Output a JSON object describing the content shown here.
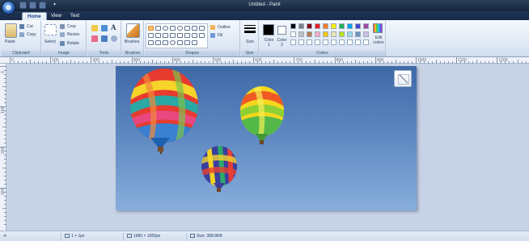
{
  "window": {
    "title": "Untitled - Paint"
  },
  "tabs": [
    {
      "label": "Home",
      "active": true
    },
    {
      "label": "View",
      "active": false
    },
    {
      "label": "Text",
      "active": false
    }
  ],
  "ribbon": {
    "clipboard": {
      "group_label": "Clipboard",
      "paste_label": "Paste",
      "cut_label": "Cut",
      "copy_label": "Copy"
    },
    "image": {
      "group_label": "Image",
      "select_label": "Select",
      "crop_label": "Crop",
      "resize_label": "Resize",
      "rotate_label": "Rotate"
    },
    "tools": {
      "group_label": "Tools",
      "text_tool_label": "A"
    },
    "brushes": {
      "group_label": "Brushes",
      "brushes_label": "Brushes"
    },
    "shapes": {
      "group_label": "Shapes",
      "outline_label": "Outline",
      "fill_label": "Fill"
    },
    "size": {
      "group_label": "Size",
      "size_label": "Size"
    },
    "colors": {
      "group_label": "Colors",
      "color1_label": "Color 1",
      "color2_label": "Color 2",
      "edit_colors_label": "Edit colors",
      "color1_value": "#000000",
      "color2_value": "#ffffff",
      "palette_row1": [
        "#000000",
        "#7f7f7f",
        "#880015",
        "#ed1c24",
        "#ff7f27",
        "#fff200",
        "#22b14c",
        "#00a2e8",
        "#3f48cc",
        "#a349a4"
      ],
      "palette_row2": [
        "#ffffff",
        "#c3c3c3",
        "#b97a57",
        "#ffaec9",
        "#ffc90e",
        "#efe4b0",
        "#b5e61d",
        "#99d9ea",
        "#7092be",
        "#c8bfe7"
      ],
      "palette_row3": [
        "#ffffff",
        "#ffffff",
        "#ffffff",
        "#ffffff",
        "#ffffff",
        "#ffffff",
        "#ffffff",
        "#ffffff",
        "#ffffff",
        "#ffffff"
      ]
    }
  },
  "ruler": {
    "top_labels": [
      "0",
      "100",
      "200",
      "300",
      "400",
      "500",
      "600",
      "700",
      "800",
      "900",
      "1000",
      "1100",
      "1200"
    ],
    "left_labels": [
      "0",
      "100",
      "200",
      "300"
    ]
  },
  "canvas": {
    "content": "Hot air balloons against a blue sky"
  },
  "statusbar": {
    "selection_size": "1 × 1px",
    "image_dimensions": "1680 × 1050px",
    "file_size": "Size: 388.8KB"
  }
}
